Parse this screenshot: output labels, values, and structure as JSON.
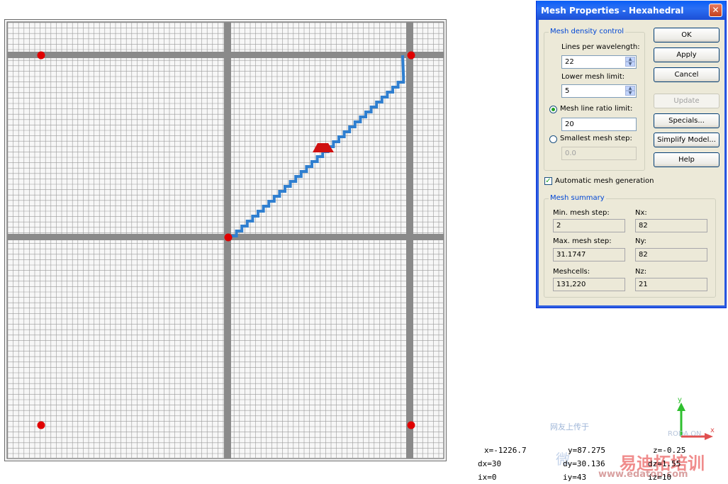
{
  "dialog": {
    "title": "Mesh Properties - Hexahedral",
    "close_label": "✕",
    "density_group": {
      "title": "Mesh density control",
      "lines_per_wavelength_label": "Lines per wavelength:",
      "lines_per_wavelength_value": "22",
      "lower_mesh_limit_label": "Lower mesh limit:",
      "lower_mesh_limit_value": "5",
      "mesh_line_ratio_label": "Mesh line ratio limit:",
      "mesh_line_ratio_value": "20",
      "mesh_line_ratio_selected": true,
      "smallest_mesh_step_label": "Smallest mesh step:",
      "smallest_mesh_step_value": "0.0",
      "smallest_mesh_step_selected": false
    },
    "buttons": {
      "ok": "OK",
      "apply": "Apply",
      "cancel": "Cancel",
      "update": "Update",
      "specials": "Specials...",
      "simplify": "Simplify Model...",
      "help": "Help"
    },
    "auto_mesh": {
      "label": "Automatic mesh generation",
      "checked": true,
      "mark": "✓"
    },
    "summary": {
      "title": "Mesh summary",
      "min_step_label": "Min. mesh step:",
      "min_step_value": "2",
      "max_step_label": "Max. mesh step:",
      "max_step_value": "31.1747",
      "meshcells_label": "Meshcells:",
      "meshcells_value": "131,220",
      "nx_label": "Nx:",
      "nx_value": "82",
      "ny_label": "Ny:",
      "ny_value": "82",
      "nz_label": "Nz:",
      "nz_value": "21"
    }
  },
  "coordinates": {
    "x": "x=-1226.7",
    "y": "y=87.275",
    "z": "z=-0.25",
    "dx": "dx=30",
    "dy": "dy=30.136",
    "dz": "dz=1.55",
    "ix": "ix=0",
    "iy": "iy=43",
    "iz": "iz=10"
  },
  "axis_labels": {
    "y": "y",
    "x": "x"
  },
  "watermark": {
    "line1": "网友上传于",
    "line2": "RODA.ON",
    "brand": "易迪拓培训",
    "site": "www.edatop.com",
    "mark": "微"
  },
  "colors": {
    "accent": "#0a5ef6",
    "port_dot": "#e00000",
    "trace": "#2f7fd0",
    "mesh_line": "#9a9a9a",
    "feed_marker": "#d01010"
  }
}
